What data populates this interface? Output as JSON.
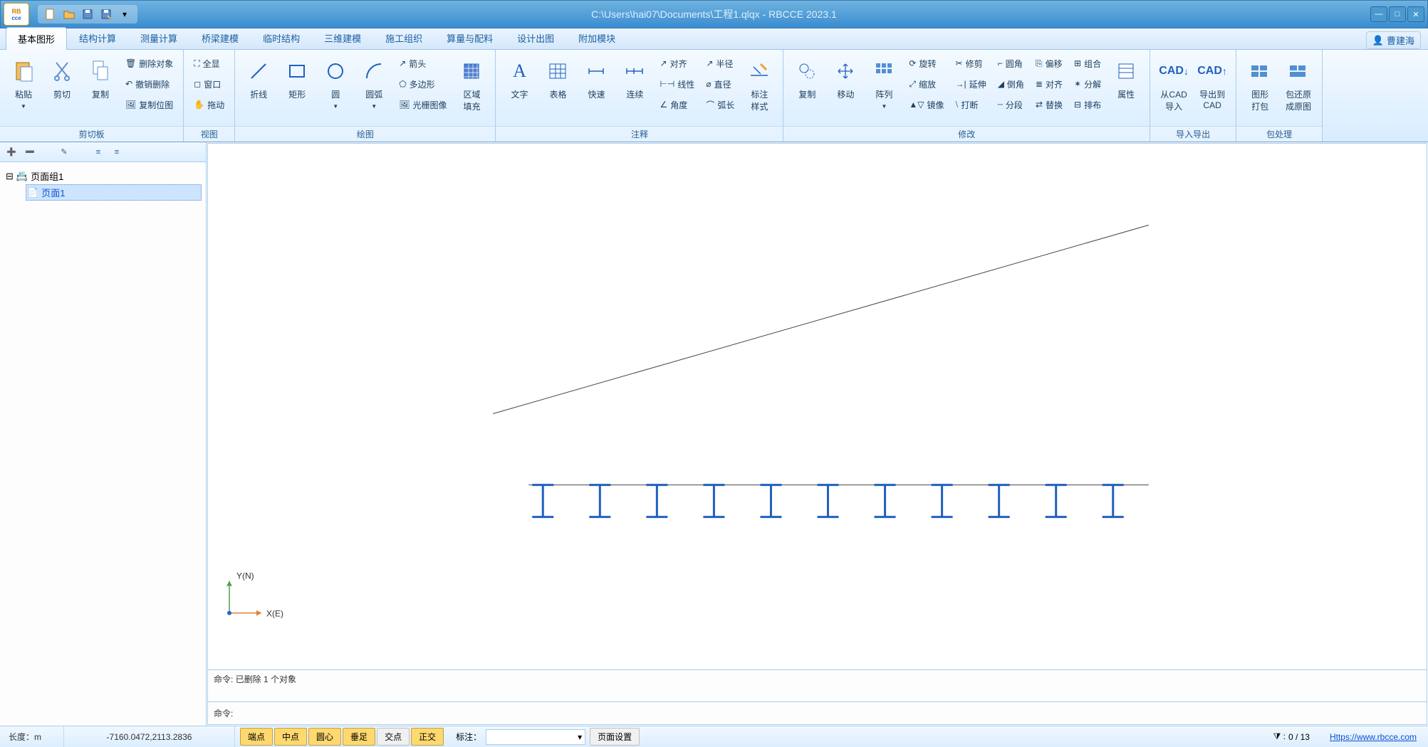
{
  "title": "C:\\Users\\hai07\\Documents\\工程1.qlqx - RBCCE 2023.1",
  "logo": {
    "top": "RB",
    "bot": "cce"
  },
  "user": "曹建海",
  "tabs": [
    "基本图形",
    "结构计算",
    "测量计算",
    "桥梁建模",
    "临时结构",
    "三维建模",
    "施工组织",
    "算量与配料",
    "设计出图",
    "附加模块"
  ],
  "ribbon": {
    "cut": {
      "paste": "粘贴",
      "cut": "剪切",
      "copy": "复制",
      "del": "删除对象",
      "undo": "撤销删除",
      "clone": "复制位图",
      "label": "剪切板"
    },
    "view": {
      "full": "全显",
      "win": "窗口",
      "drag": "拖动",
      "label": "视图"
    },
    "draw": {
      "line": "折线",
      "rect": "矩形",
      "circle": "圆",
      "arc": "圆弧",
      "arrow": "箭头",
      "poly": "多边形",
      "raster": "光栅图像",
      "fill": "区域\n填充",
      "label": "绘图"
    },
    "anno": {
      "text": "文字",
      "table": "表格",
      "quick": "快速",
      "cont": "连续",
      "align": "对齐",
      "linear": "线性",
      "angle": "角度",
      "radius": "半径",
      "diameter": "直径",
      "arclen": "弧长",
      "style": "标注\n样式",
      "label": "注释"
    },
    "mod": {
      "copy": "复制",
      "move": "移动",
      "array": "阵列",
      "rotate": "旋转",
      "scale": "缩放",
      "mirror": "镜像",
      "trim": "修剪",
      "extend": "延伸",
      "break": "打断",
      "fillet": "圆角",
      "chamfer": "倒角",
      "seg": "分段",
      "offset": "偏移",
      "alignm": "对齐",
      "replace": "替换",
      "group": "组合",
      "explode": "分解",
      "arrange": "排布",
      "label": "修改"
    },
    "attr": {
      "attr": "属性"
    },
    "io": {
      "importcad": "从CAD\n导入",
      "exportcad": "导出到\nCAD",
      "label": "导入导出"
    },
    "pack": {
      "packimg": "图形\n打包",
      "restore": "包还原\n成原图",
      "label": "包处理"
    }
  },
  "tree": {
    "root": "页面组1",
    "child": "页面1"
  },
  "canvas": {
    "xaxis": "X(E)",
    "yaxis": "Y(N)"
  },
  "cmd": {
    "history": "命令: 已删除 1 个对象",
    "prompt": "命令:"
  },
  "status": {
    "length": "长度：m",
    "coords": "-7160.0472,2113.2836",
    "snaps": [
      "端点",
      "中点",
      "圆心",
      "垂足",
      "交点",
      "正交"
    ],
    "label": "标注：",
    "pageset": "页面设置",
    "count": "0 / 13",
    "url": "Https://www.rbcce.com"
  }
}
